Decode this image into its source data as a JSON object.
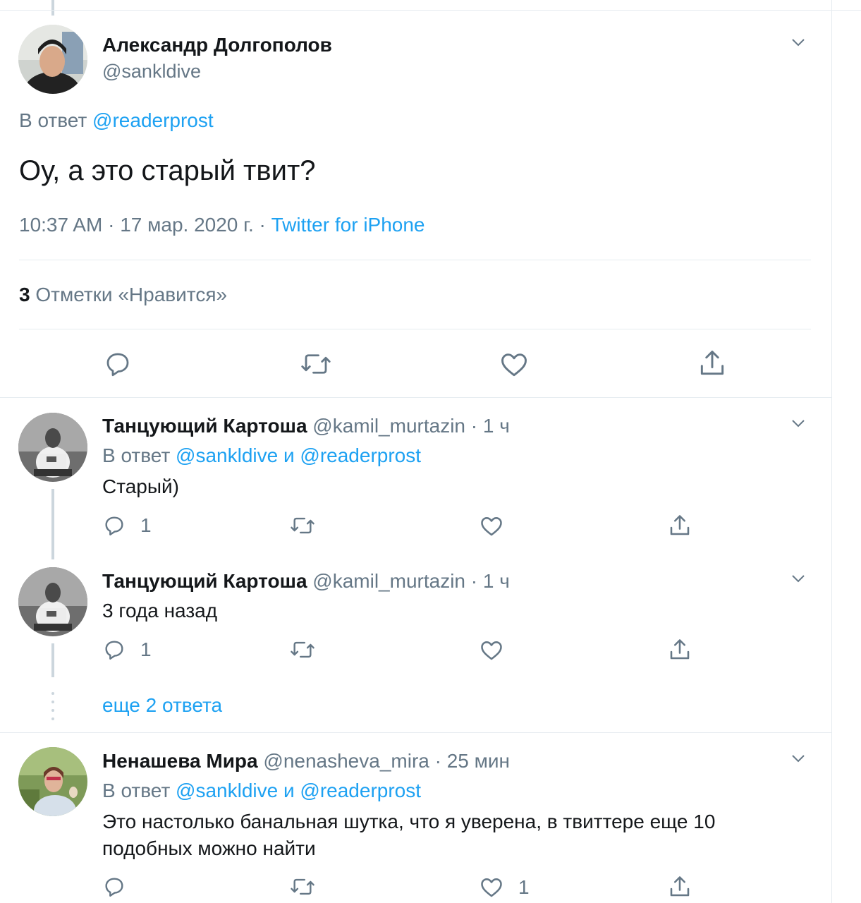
{
  "main_tweet": {
    "author_name": "Александр Долгополов",
    "handle": "@sankldive",
    "reply_prefix": "В ответ",
    "reply_to": "@readerprost",
    "text": "Оу, а это старый твит?",
    "time": "10:37 AM",
    "date": "17 мар. 2020 г.",
    "source": "Twitter for iPhone",
    "likes_count": "3",
    "likes_label": "Отметки «Нравится»"
  },
  "replies": [
    {
      "author_name": "Танцующий Картоша",
      "handle": "@kamil_murtazin",
      "time": "1 ч",
      "reply_prefix": "В ответ",
      "reply_to_1": "@sankldive",
      "reply_and": "и",
      "reply_to_2": "@readerprost",
      "text": "Старый)",
      "reply_count": "1",
      "like_count": ""
    },
    {
      "author_name": "Танцующий Картоша",
      "handle": "@kamil_murtazin",
      "time": "1 ч",
      "text": "3 года назад",
      "reply_count": "1",
      "like_count": ""
    },
    {
      "author_name": "Ненашева Мира",
      "handle": "@nenasheva_mira",
      "time": "25 мин",
      "reply_prefix": "В ответ",
      "reply_to_1": "@sankldive",
      "reply_and": "и",
      "reply_to_2": "@readerprost",
      "text_line1": "Это настолько банальная шутка, что я уверена, в твиттере еще 10",
      "text_line2": "подобных можно найти",
      "reply_count": "",
      "like_count": "1"
    }
  ],
  "more_replies": "еще 2 ответа",
  "separator_dot": "·",
  "icons": [
    "chevron-down-icon",
    "reply-icon",
    "retweet-icon",
    "like-icon",
    "share-icon"
  ],
  "colors": {
    "link": "#1da1f2",
    "muted": "#657786",
    "text": "#14171a",
    "border": "#e6ecf0"
  }
}
